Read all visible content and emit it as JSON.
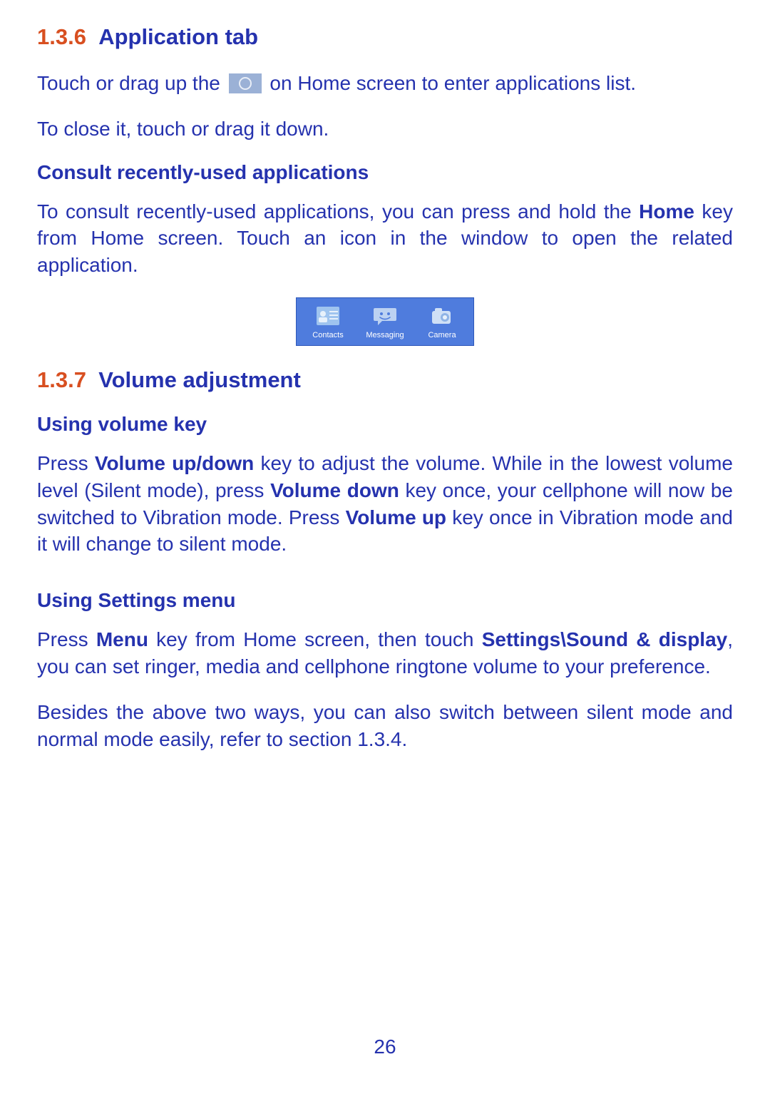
{
  "page_number": "26",
  "sections": {
    "app_tab": {
      "num": "1.3.6",
      "title": "Application tab",
      "p1_a": "Touch or drag up the ",
      "p1_b": " on Home screen to enter applications list.",
      "p2": "To close it, touch or drag it down.",
      "sub1_title": "Consult recently-used applications",
      "sub1_p_a": "To consult recently-used applications, you can press and hold the ",
      "sub1_p_bold": "Home",
      "sub1_p_b": " key from Home screen. Touch an icon in the window to open the related application."
    },
    "recent_apps": {
      "items": [
        {
          "label": "Contacts"
        },
        {
          "label": "Messaging"
        },
        {
          "label": "Camera"
        }
      ]
    },
    "volume": {
      "num": "1.3.7",
      "title": "Volume adjustment",
      "sub1_title": "Using volume key",
      "sub1_p_a": "Press ",
      "sub1_p_b1": "Volume up/down",
      "sub1_p_c": " key to adjust the volume. While in the lowest volume level (Silent mode), press ",
      "sub1_p_b2": "Volume down",
      "sub1_p_d": " key once, your cellphone will now be switched to Vibration mode. Press ",
      "sub1_p_b3": "Volume up",
      "sub1_p_e": " key once in Vibration mode and it will change to silent mode.",
      "sub2_title": "Using Settings menu",
      "sub2_p_a": "Press ",
      "sub2_p_b1": "Menu",
      "sub2_p_b": " key from Home screen, then touch ",
      "sub2_p_b2": "Settings\\Sound & display",
      "sub2_p_c": ", you can set ringer, media and cellphone ringtone volume to your preference.",
      "p_last": "Besides the above two ways, you can also switch between silent mode and normal mode easily, refer to section 1.3.4."
    }
  }
}
